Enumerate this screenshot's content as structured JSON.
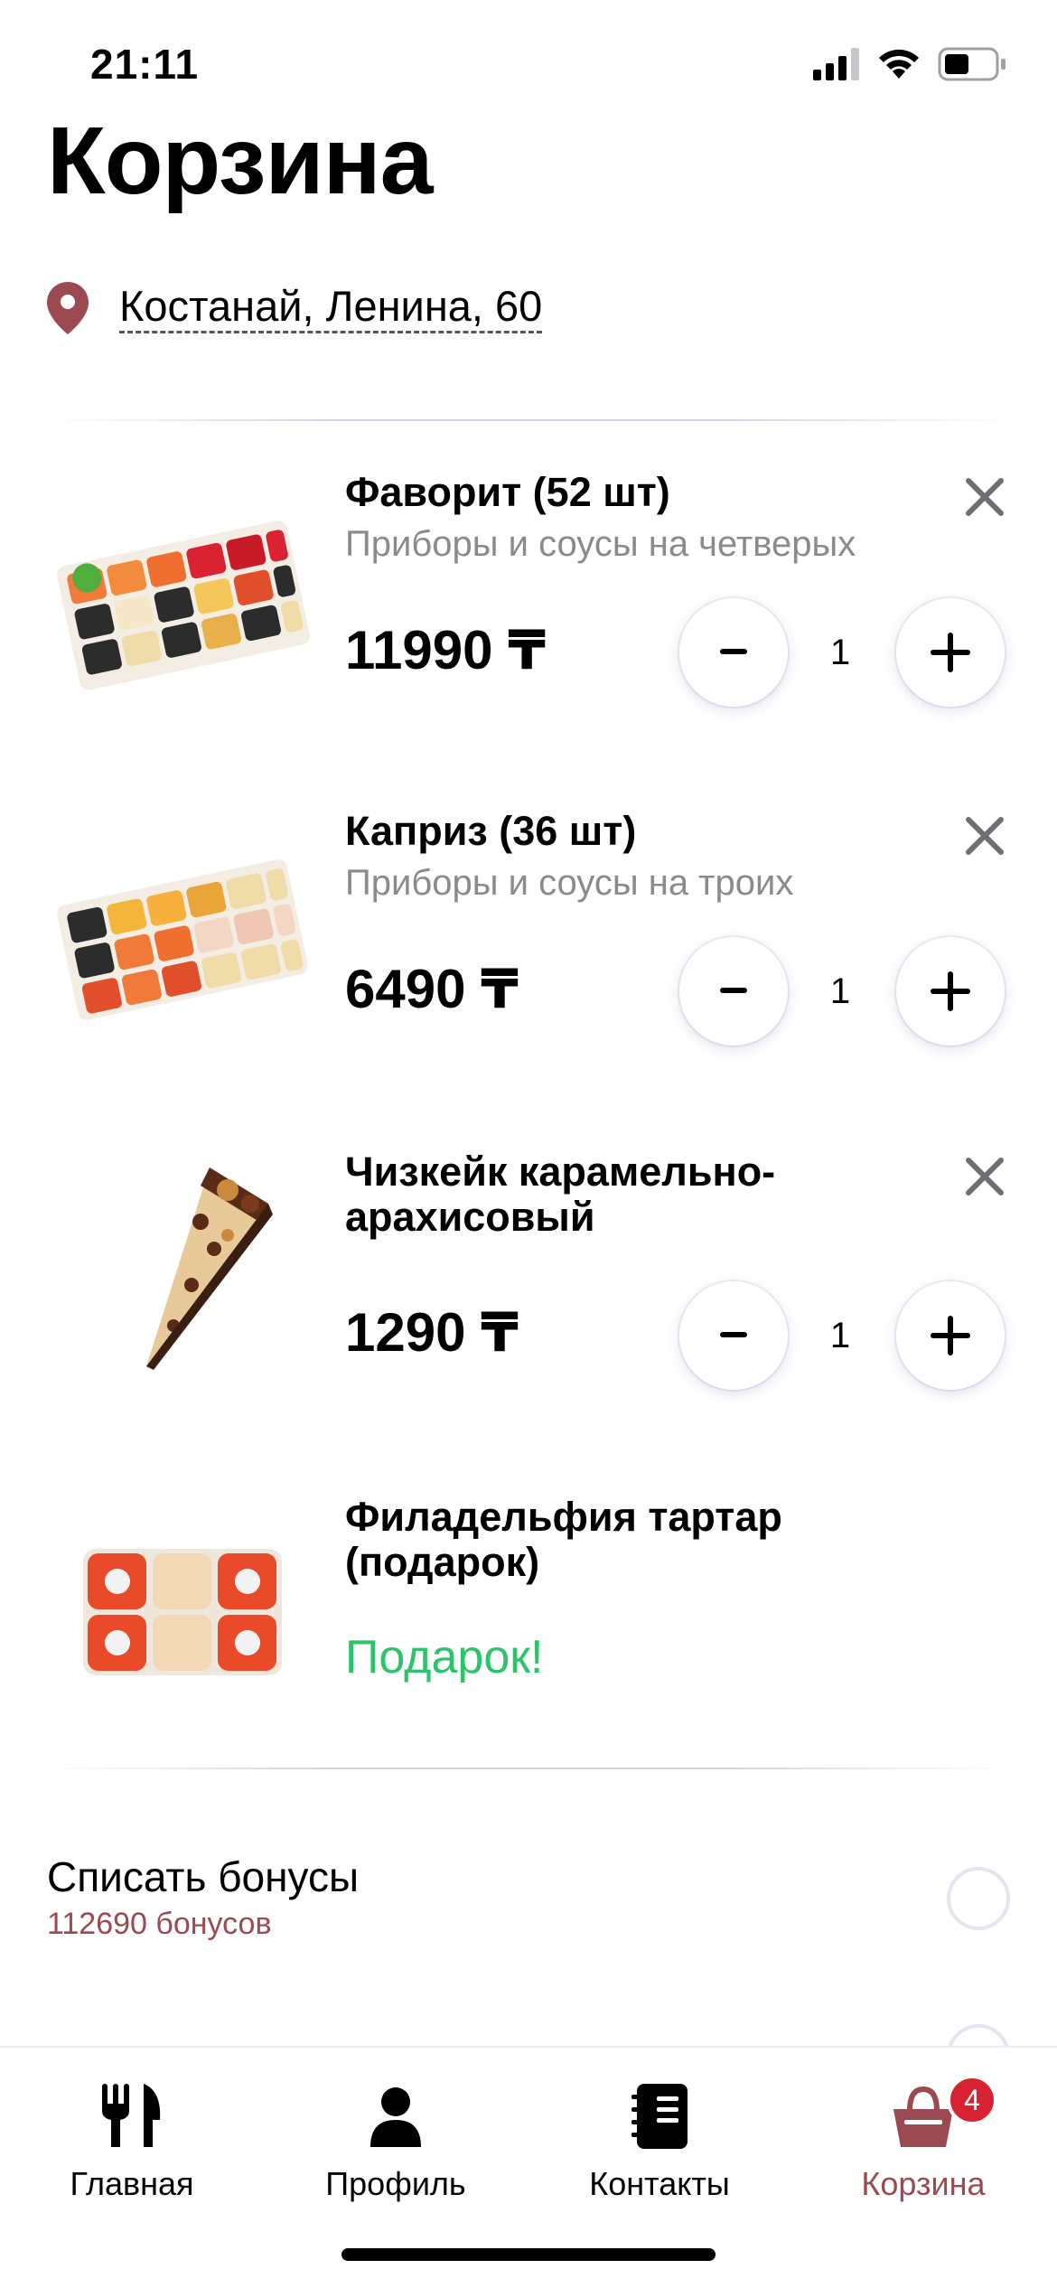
{
  "status": {
    "time": "21:11"
  },
  "header": {
    "title": "Корзина"
  },
  "address": {
    "text": "Костанай, Ленина, 60"
  },
  "items": [
    {
      "name": "Фаворит (52 шт)",
      "subtitle": "Приборы и соусы на четверых",
      "price": "11990 ₸",
      "quantity": "1",
      "image": "sushi-set-favorit"
    },
    {
      "name": "Каприз (36 шт)",
      "subtitle": "Приборы и соусы на троих",
      "price": "6490 ₸",
      "quantity": "1",
      "image": "sushi-set-kapriz"
    },
    {
      "name": "Чизкейк карамельно-арахисовый",
      "price": "1290 ₸",
      "quantity": "1",
      "image": "cheesecake-slice"
    },
    {
      "name": "Филадельфия тартар (подарок)",
      "gift_label": "Подарок!",
      "image": "philadelphia-roll"
    }
  ],
  "bonus": {
    "title": "Списать бонусы",
    "amount": "112690 бонусов"
  },
  "tabs": [
    {
      "label": "Главная",
      "icon": "fork-knife-icon"
    },
    {
      "label": "Профиль",
      "icon": "person-icon"
    },
    {
      "label": "Контакты",
      "icon": "notebook-icon"
    },
    {
      "label": "Корзина",
      "icon": "basket-icon",
      "badge": "4",
      "active": true
    }
  ],
  "colors": {
    "accent": "#9b4a52",
    "gift": "#2ec26a",
    "badge": "#d72231",
    "muted": "#8a8a8f"
  }
}
